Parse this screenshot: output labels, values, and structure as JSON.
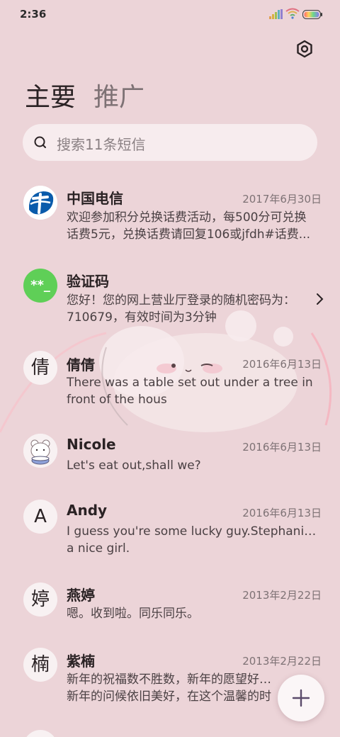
{
  "status_bar": {
    "time": "2:36"
  },
  "tabs": [
    {
      "label": "主要",
      "active": true
    },
    {
      "label": "推广",
      "active": false
    }
  ],
  "search": {
    "placeholder": "搜索11条短信"
  },
  "conversations": [
    {
      "name": "中国电信",
      "date": "2017年6月30日",
      "preview_lines": [
        "欢迎参加积分兑换话费活动，每500分可兑换",
        "话费5元，兑换话费请回复106或jfdh#话费..."
      ],
      "avatar": "china-telecom-logo"
    },
    {
      "name": "验证码",
      "date": "",
      "preview_lines": [
        "您好！您的网上营业厅登录的随机密码为：",
        "710679，有效时间为3分钟"
      ],
      "avatar": "verification-code-icon",
      "avatar_text": "**_"
    },
    {
      "name": "倩倩",
      "date": "2016年6月13日",
      "preview_lines": [
        "There was a table set out under a tree in",
        "front of the hous"
      ],
      "avatar": "letter",
      "avatar_text": "倩"
    },
    {
      "name": "Nicole",
      "date": "2016年6月13日",
      "preview_lines": [
        "Let's eat out,shall we?"
      ],
      "avatar": "bear-drum-photo"
    },
    {
      "name": "Andy",
      "date": "2016年6月13日",
      "preview_lines": [
        "I guess you're some lucky guy.Stephanie is",
        "a nice girl."
      ],
      "avatar": "letter",
      "avatar_text": "A"
    },
    {
      "name": "燕婷",
      "date": "2013年2月22日",
      "preview_lines": [
        "嗯。收到啦。同乐同乐。"
      ],
      "avatar": "letter",
      "avatar_text": "婷"
    },
    {
      "name": "紫楠",
      "date": "2013年2月22日",
      "preview_lines": [
        "新年的祝福数不胜数，新年的愿望好多好",
        "新年的问候依旧美好，在这个温馨的时"
      ],
      "avatar": "letter",
      "avatar_text": "楠"
    }
  ],
  "colors": {
    "background": "#ecd4d8",
    "verification_avatar": "#5fcf57",
    "telecom_blue": "#0a5bab"
  }
}
